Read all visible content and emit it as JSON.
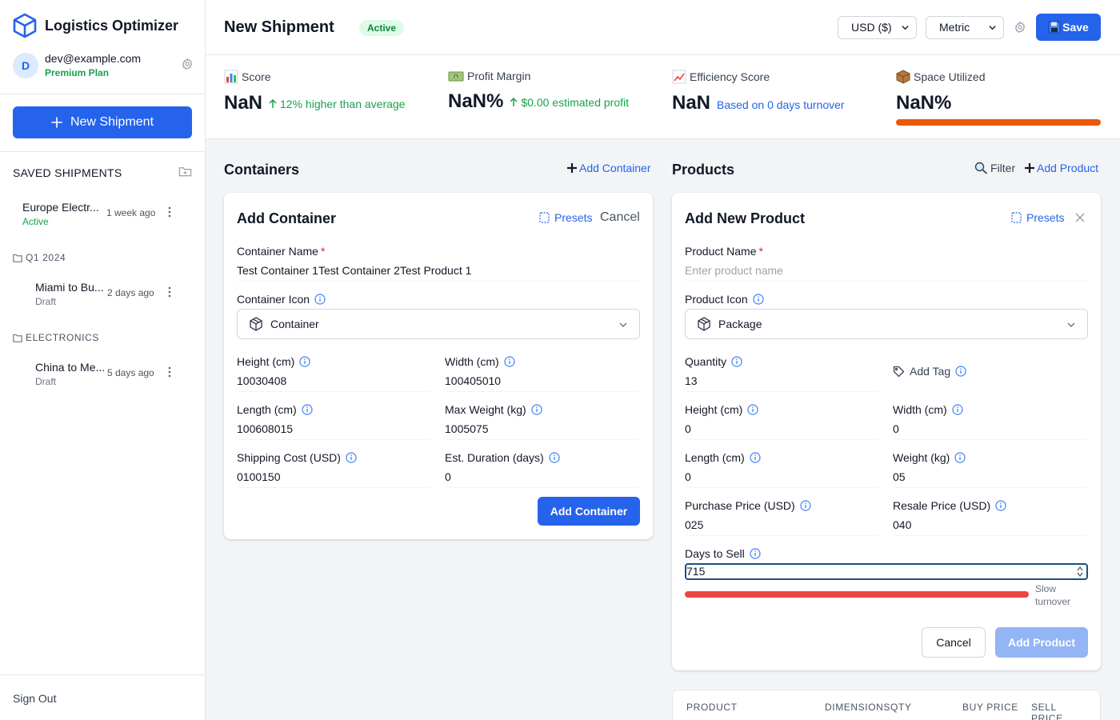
{
  "app": {
    "name": "Logistics Optimizer"
  },
  "user": {
    "initial": "D",
    "email": "dev@example.com",
    "plan": "Premium Plan"
  },
  "sidebar": {
    "new_shipment_label": "New Shipment",
    "saved_title": "SAVED SHIPMENTS",
    "ungrouped": [
      {
        "name": "Europe Electr...",
        "status": "Active",
        "time": "1 week ago"
      }
    ],
    "groups": [
      {
        "label": "Q1 2024",
        "items": [
          {
            "name": "Miami to Bu...",
            "status": "Draft",
            "time": "2 days ago"
          }
        ]
      },
      {
        "label": "ELECTRONICS",
        "items": [
          {
            "name": "China to Me...",
            "status": "Draft",
            "time": "5 days ago"
          }
        ]
      }
    ],
    "sign_out": "Sign Out"
  },
  "header": {
    "title": "New Shipment",
    "status": "Active",
    "currency": "USD ($)",
    "units": "Metric",
    "save_label": "Save"
  },
  "stats": {
    "score": {
      "label": "Score",
      "value": "NaN",
      "sub": "12% higher than average"
    },
    "profit": {
      "label": "Profit Margin",
      "value": "NaN%",
      "sub": "$0.00 estimated profit"
    },
    "efficiency": {
      "label": "Efficiency Score",
      "value": "NaN",
      "sub": "Based on 0 days turnover"
    },
    "space": {
      "label": "Space Utilized",
      "value": "NaN%",
      "fill_percent": 100
    }
  },
  "containers": {
    "title": "Containers",
    "add_link": "Add Container",
    "form": {
      "title": "Add Container",
      "presets": "Presets",
      "cancel": "Cancel",
      "name_label": "Container Name",
      "name_value": "Test Container 1Test Container 2Test Product 1",
      "icon_label": "Container Icon",
      "icon_value": "Container",
      "height_label": "Height (cm)",
      "height_value": "10030408",
      "width_label": "Width (cm)",
      "width_value": "100405010",
      "length_label": "Length (cm)",
      "length_value": "100608015",
      "max_weight_label": "Max Weight (kg)",
      "max_weight_value": "1005075",
      "cost_label": "Shipping Cost (USD)",
      "cost_value": "0100150",
      "duration_label": "Est. Duration (days)",
      "duration_value": "0",
      "submit": "Add Container"
    }
  },
  "products": {
    "title": "Products",
    "filter": "Filter",
    "add_link": "Add Product",
    "form": {
      "title": "Add New Product",
      "presets": "Presets",
      "name_label": "Product Name",
      "name_placeholder": "Enter product name",
      "icon_label": "Product Icon",
      "icon_value": "Package",
      "quantity_label": "Quantity",
      "quantity_value": "13",
      "tag_label": "Add Tag",
      "height_label": "Height (cm)",
      "height_value": "0",
      "width_label": "Width (cm)",
      "width_value": "0",
      "length_label": "Length (cm)",
      "length_value": "0",
      "weight_label": "Weight (kg)",
      "weight_value": "05",
      "purchase_label": "Purchase Price (USD)",
      "purchase_value": "025",
      "resale_label": "Resale Price (USD)",
      "resale_value": "040",
      "days_label": "Days to Sell",
      "days_value": "715",
      "turnover_label": "Slow turnover",
      "cancel": "Cancel",
      "submit": "Add Product"
    },
    "table_headers": [
      "PRODUCT",
      "DIMENSIONS",
      "QTY",
      "BUY PRICE",
      "SELL PRICE"
    ]
  },
  "colors": {
    "primary": "#2563eb",
    "success": "#16a34a",
    "warning": "#ea580c",
    "danger": "#ef4444"
  }
}
